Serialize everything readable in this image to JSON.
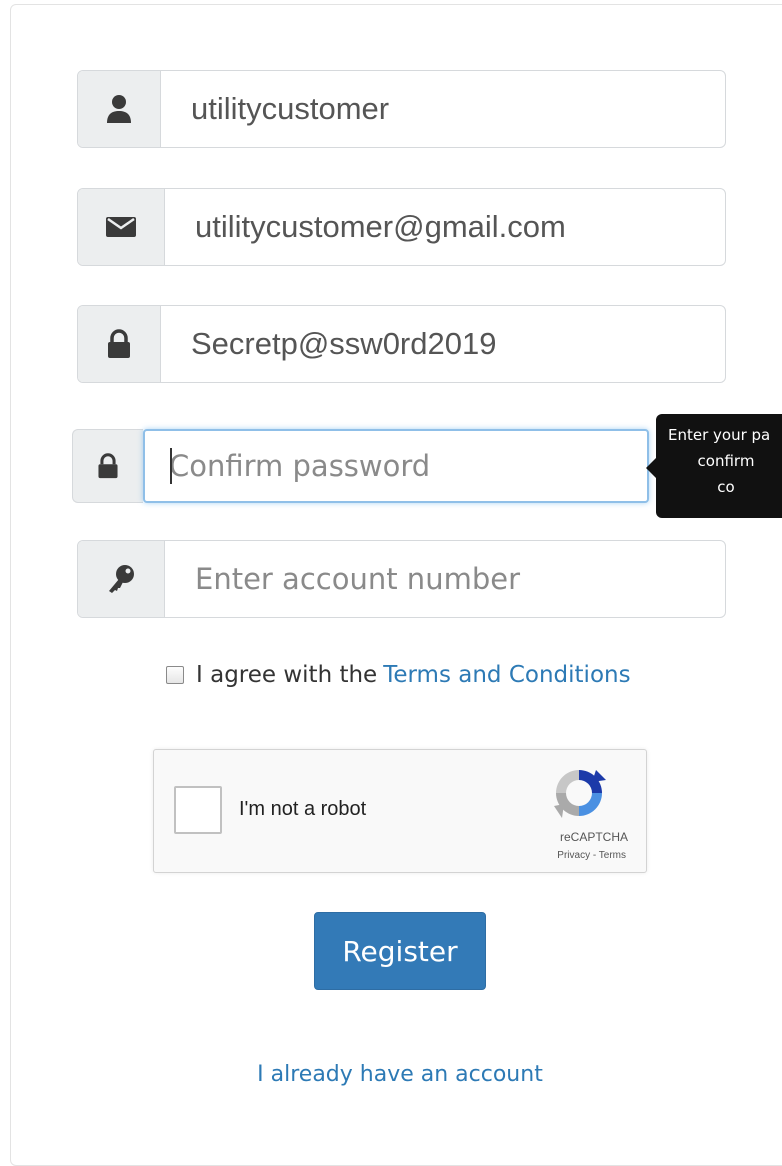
{
  "form": {
    "username": {
      "icon": "user-icon",
      "value": "utilitycustomer"
    },
    "email": {
      "icon": "envelope-icon",
      "value": "utilitycustomer@gmail.com"
    },
    "password": {
      "icon": "lock-icon",
      "value": "Secretp@ssw0rd2019"
    },
    "confirm_password": {
      "icon": "lock-icon",
      "value": "",
      "placeholder": "Confirm password",
      "focused": true
    },
    "account_number": {
      "icon": "key-icon",
      "value": "",
      "placeholder": "Enter account number"
    },
    "agree": {
      "prefix": "I agree with the",
      "link": "Terms and Conditions",
      "checked": false
    },
    "recaptcha": {
      "label": "I'm not a robot",
      "brand": "reCAPTCHA",
      "links": "Privacy - Terms"
    },
    "register_label": "Register",
    "have_account_link": "I already have an account"
  },
  "tooltip": {
    "line1": "Enter your pa",
    "line2": "confirm",
    "line3": "co"
  },
  "colors": {
    "primary": "#337ab7",
    "link": "#2d7ab5",
    "tooltip_bg": "#111111",
    "addon_bg": "#eceeef",
    "focus_border": "#8fbfe8"
  }
}
